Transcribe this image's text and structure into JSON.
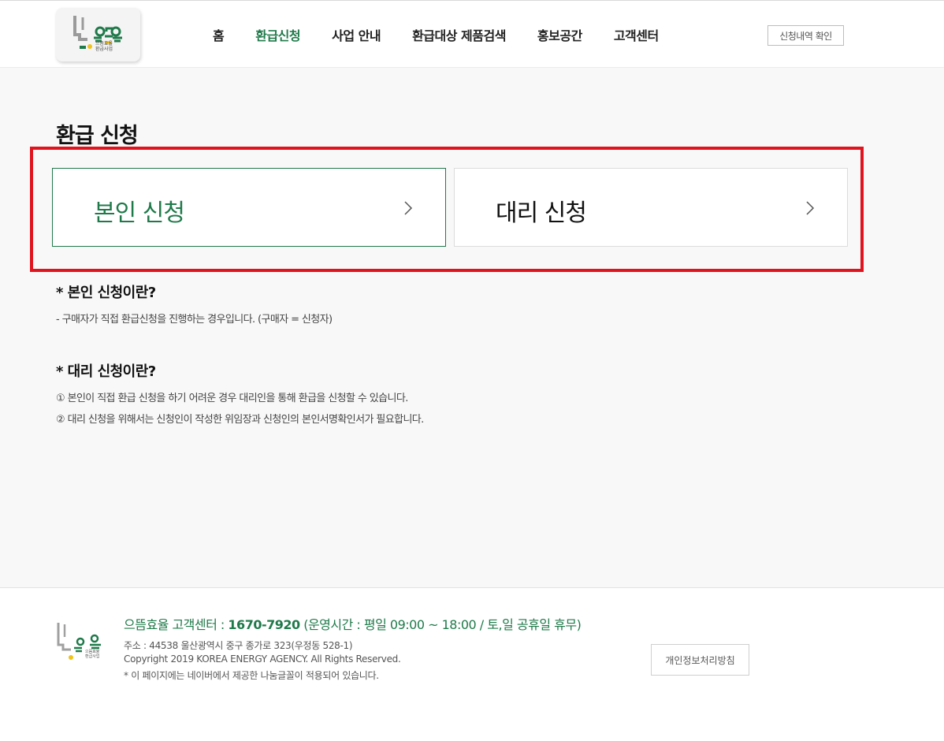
{
  "header": {
    "logo": {
      "text_line1": "으뜸효율",
      "text_line2": "환급사업"
    },
    "nav": [
      {
        "label": "홈",
        "active": false
      },
      {
        "label": "환급신청",
        "active": true
      },
      {
        "label": "사업 안내",
        "active": false
      },
      {
        "label": "환급대상 제품검색",
        "active": false
      },
      {
        "label": "홍보공간",
        "active": false
      },
      {
        "label": "고객센터",
        "active": false
      }
    ],
    "check_button_label": "신청내역 확인"
  },
  "main": {
    "title": "환급 신청",
    "options": [
      {
        "label": "본인 신청",
        "icon": "chevron-right-icon"
      },
      {
        "label": "대리 신청",
        "icon": "chevron-right-icon"
      }
    ],
    "self_info": {
      "heading": "* 본인 신청이란?",
      "lines": [
        "- 구매자가 직접 환급신청을 진행하는 경우입니다. (구매자 = 신청자)"
      ]
    },
    "proxy_info": {
      "heading": "* 대리 신청이란?",
      "lines": [
        "① 본인이 직접 환급 신청을 하기 어려운 경우 대리인을 통해 환급을 신청할 수 있습니다.",
        "② 대리 신청을 위해서는 신청인이 작성한 위임장과 신청인의 본인서명확인서가 필요합니다."
      ]
    }
  },
  "footer": {
    "logo": {
      "text_line1": "으뜸효율",
      "text_line2": "환급사업"
    },
    "center_prefix": "으뜸효율 고객센터 : ",
    "center_phone": "1670-7920",
    "center_hours": " (운영시간 : 평일 09:00 ~ 18:00 / 토,일 공휴일 휴무)",
    "address": "주소 : 44538 울산광역시 중구 종가로 323(우정동 528-1)",
    "copyright": "Copyright 2019 KOREA ENERGY AGENCY. All Rights Reserved.",
    "font_notice": "* 이 페이지에는 네이버에서 제공한 나눔글꼴이 적용되어 있습니다.",
    "privacy_button_label": "개인정보처리방침"
  },
  "colors": {
    "accent": "#1f7a4a",
    "highlight": "#e0141e",
    "background": "#f8f8f8"
  }
}
